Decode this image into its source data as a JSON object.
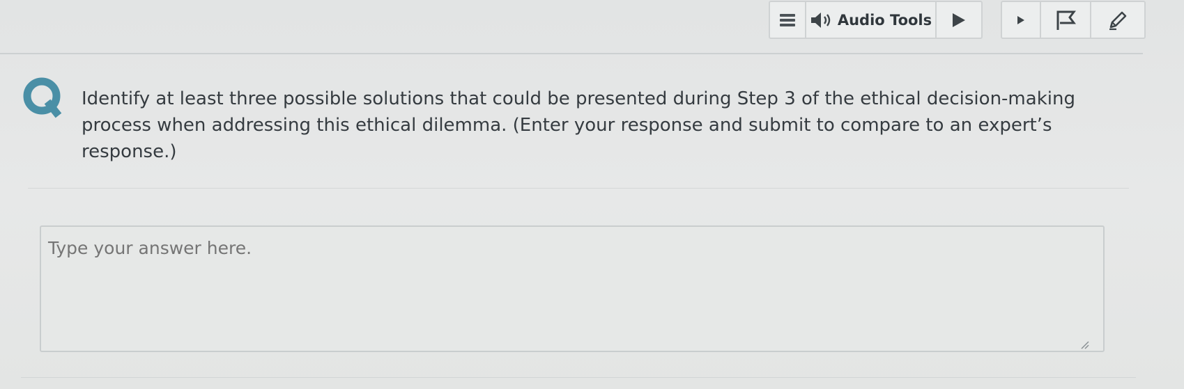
{
  "toolbar": {
    "audio_label": "Audio Tools",
    "icons": [
      "menu-icon",
      "speaker-icon",
      "play-icon",
      "small-play-icon",
      "flag-icon",
      "pencil-icon"
    ]
  },
  "question": {
    "text": "Identify at least three possible solutions that could be presented during Step 3 of the ethical decision-making process when addressing this ethical dilemma. (Enter your response and submit to compare to an expert’s response.)"
  },
  "answer": {
    "value": "",
    "placeholder": "Type your answer here."
  },
  "colors": {
    "accent": "#4a8fa6",
    "background": "#e4e6e6",
    "text": "#353b40"
  }
}
